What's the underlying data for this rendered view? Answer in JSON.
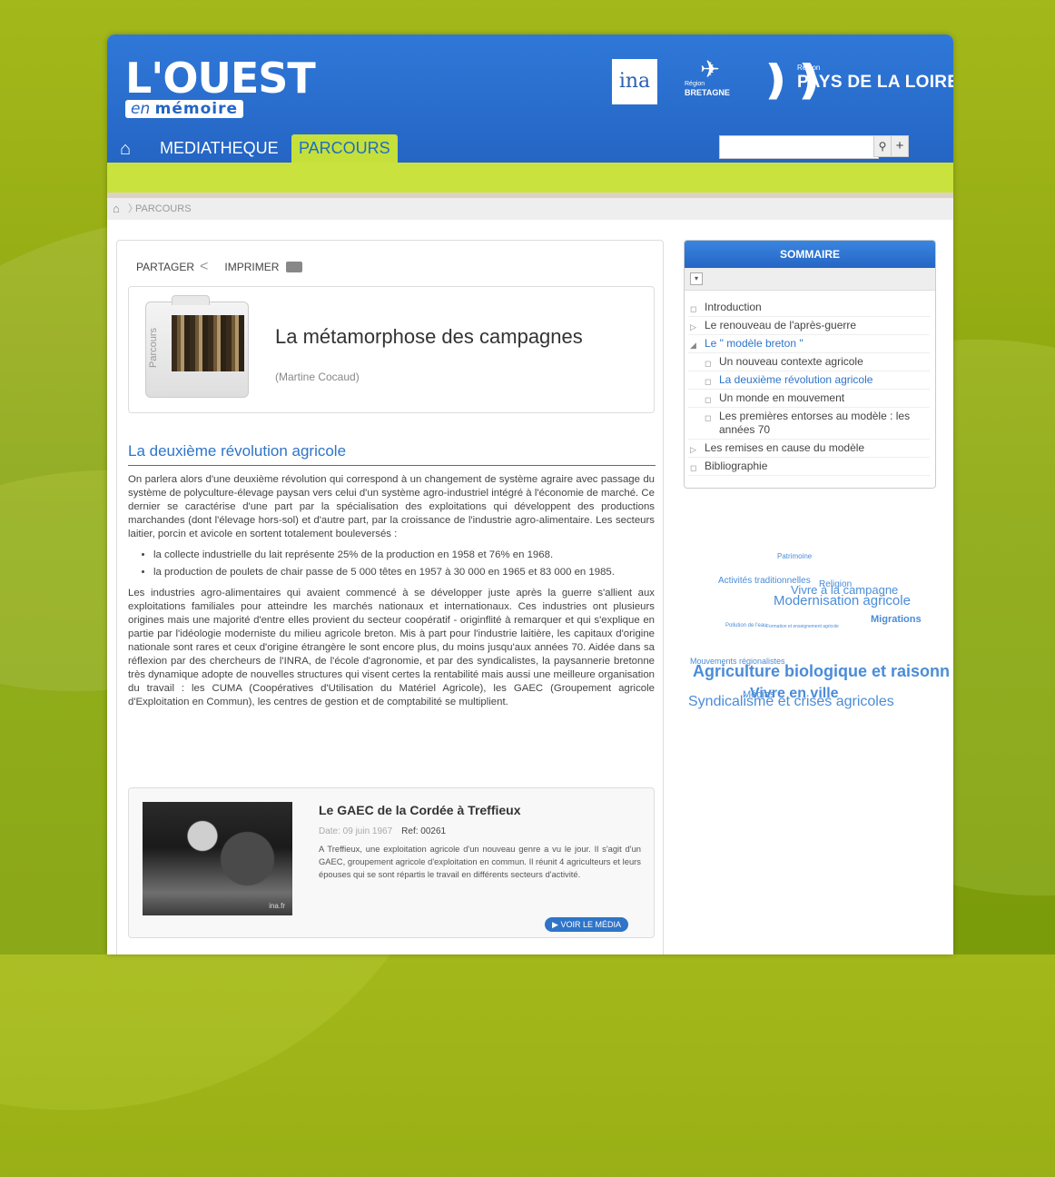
{
  "brand": {
    "logo_main": "L'OUEST",
    "logo_sub_prefix": "en",
    "logo_sub_word": "mémoire",
    "ina": "ina",
    "bretagne_small": "Région",
    "bretagne": "BRETAGNE",
    "pdl_region": "Région",
    "pdl_name": "PAYS DE LA LOIRE"
  },
  "nav": {
    "tabs": [
      {
        "label": "MEDIATHEQUE"
      },
      {
        "label": "PARCOURS"
      }
    ],
    "search_placeholder": ""
  },
  "breadcrumb": {
    "label": "PARCOURS"
  },
  "toolbar": {
    "share_label": "PARTAGER",
    "print_label": "IMPRIMER"
  },
  "parcours": {
    "folder_label": "Parcours",
    "title": "La métamorphose des campagnes",
    "author": "(Martine Cocaud)"
  },
  "section": {
    "title": "La deuxième révolution agricole",
    "para1": "On parlera alors d'une deuxième révolution qui correspond à un changement de système agraire avec passage du système de polyculture-élevage paysan vers celui d'un système agro-industriel intégré à l'économie de marché. Ce dernier se caractérise d'une part par la spécialisation des exploitations qui développent des productions marchandes (dont l'élevage hors-sol) et d'autre part, par la croissance de l'industrie agro-alimentaire. Les secteurs laitier, porcin et avicole en sortent totalement bouleversés :",
    "bullets": [
      "la collecte industrielle du lait représente 25% de la production en 1958 et 76% en 1968.",
      "la production de poulets de chair passe de 5 000 têtes en 1957 à 30 000 en 1965 et 83 000 en 1985."
    ],
    "para2": "Les industries agro-alimentaires qui avaient commencé à se développer juste après la guerre s'allient aux exploitations familiales pour atteindre les marchés nationaux et internationaux. Ces industries ont plusieurs origines mais une majorité d'entre elles provient du secteur coopératif - originflité à remarquer et qui s'explique en partie par l'idéologie moderniste du milieu agricole breton. Mis à part pour l'industrie laitière, les capitaux d'origine nationale sont rares et ceux d'origine étrangère le sont encore plus, du moins jusqu'aux années 70. Aidée dans sa réflexion par des chercheurs de l'INRA, de l'école d'agronomie, et par des syndicalistes, la paysannerie bretonne très dynamique adopte de nouvelles structures qui visent certes la rentabilité mais aussi une meilleure organisation du travail : les CUMA (Coopératives d'Utilisation du Matériel Agricole), les GAEC (Groupement agricole d'Exploitation en Commun), les centres de gestion et de comptabilité se multiplient."
  },
  "media": {
    "title": "Le GAEC de la Cordée à Treffieux",
    "date": "Date: 09 juin 1967",
    "ref": "Ref: 00261",
    "description": "A Treffieux, une exploitation agricole d'un nouveau genre a vu le jour. Il s'agit d'un GAEC, groupement agricole d'exploitation en commun. Il réunit 4 agriculteurs et leurs épouses qui se sont répartis le travail en différents secteurs d'activité.",
    "watermark": "ina.fr",
    "button": "VOIR LE MÉDIA"
  },
  "sommaire": {
    "title": "SOMMAIRE",
    "items": [
      {
        "label": "Introduction"
      },
      {
        "label": "Le renouveau de l'après-guerre"
      },
      {
        "label": "Le \" modèle breton \""
      },
      {
        "label": "Un nouveau contexte agricole"
      },
      {
        "label": "La deuxième révolution agricole"
      },
      {
        "label": "Un monde en mouvement"
      },
      {
        "label": "Les premières entorses au modèle : les années 70"
      },
      {
        "label": "Les remises en cause du modèle"
      },
      {
        "label": "Bibliographie"
      }
    ]
  },
  "tag_cloud": [
    "Patrimoine",
    "Activités traditionnelles",
    "Religion",
    "Vivre à la campagne",
    "Modernisation agricole",
    "Migrations",
    "Pollution de l'eau",
    "Formation et enseignement agricole",
    "Mouvements régionalistes",
    "Agriculture biologique et raisonnée",
    "Médias",
    "Vivre en ville",
    "Syndicalisme et crises agricoles"
  ],
  "colors": {
    "header_blue": "#2565c4",
    "accent_green": "#c9e23d",
    "link_blue": "#2f74c8",
    "background_green": "#96ad14"
  }
}
